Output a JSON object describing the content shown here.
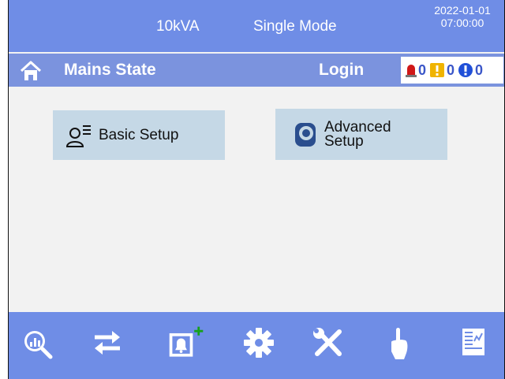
{
  "status_bar": {
    "capacity": "10kVA",
    "mode": "Single Mode",
    "date": "2022-01-01",
    "time": "07:00:00"
  },
  "title_bar": {
    "home_icon": "home-icon",
    "title": "Mains State",
    "login_label": "Login",
    "alarms": [
      {
        "icon": "red-alarm-light-icon",
        "count": "0"
      },
      {
        "icon": "yellow-warning-icon",
        "count": "0"
      },
      {
        "icon": "blue-info-icon",
        "count": "0"
      }
    ]
  },
  "menu": {
    "basic": {
      "icon": "user-list-icon",
      "label": "Basic Setup"
    },
    "advanced": {
      "icon": "advanced-setup-icon",
      "label_line1": "Advanced",
      "label_line2": "Setup"
    }
  },
  "toolbar": {
    "buttons": [
      {
        "icon": "analytics-search-icon"
      },
      {
        "icon": "transfer-arrows-icon"
      },
      {
        "icon": "alarm-add-icon"
      },
      {
        "icon": "gear-icon"
      },
      {
        "icon": "tools-icon"
      },
      {
        "icon": "touch-hand-icon"
      },
      {
        "icon": "log-report-icon"
      }
    ]
  },
  "colors": {
    "status_bar": "#6f8de6",
    "title_bar": "#7b93de",
    "tile": "#c5d8e6",
    "background": "#f2f2f2"
  }
}
